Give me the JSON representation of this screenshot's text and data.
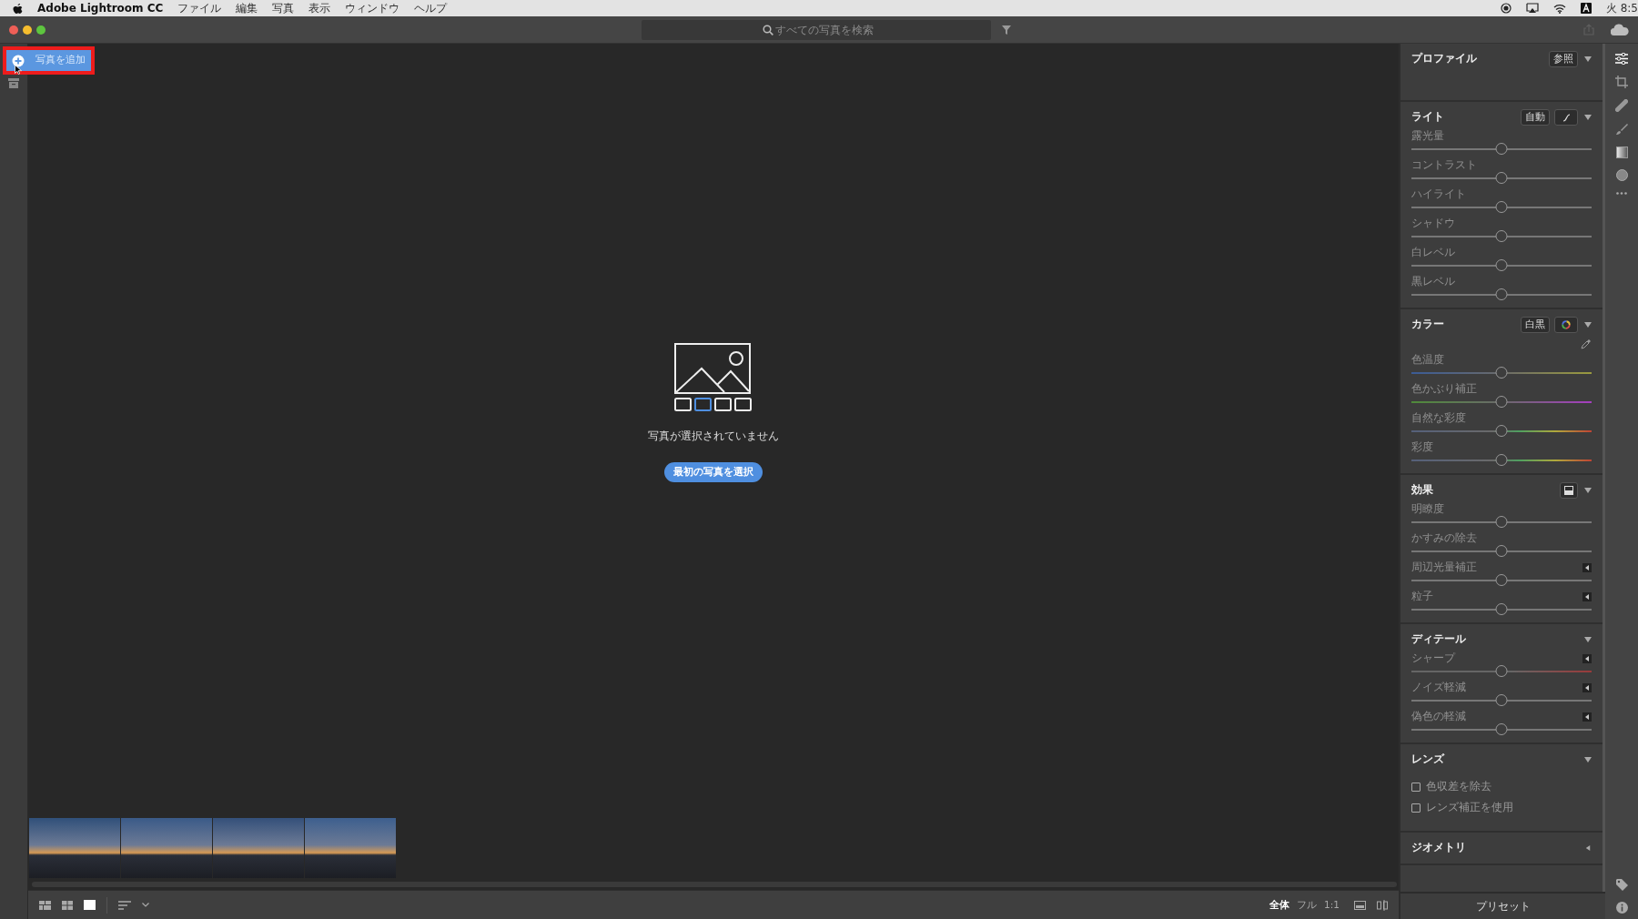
{
  "menu_bar": {
    "app_name": "Adobe Lightroom CC",
    "menus": [
      "ファイル",
      "編集",
      "写真",
      "表示",
      "ウィンドウ",
      "ヘルプ"
    ],
    "clock": "火 8:5"
  },
  "toolbar": {
    "search": {
      "placeholder": "すべての写真を検索"
    }
  },
  "add_photo_button": {
    "label": "写真を追加",
    "highlighted": true
  },
  "empty_state": {
    "message": "写真が選択されていません",
    "button": "最初の写真を選択"
  },
  "zoom_options": [
    {
      "label": "全体",
      "selected": true
    },
    {
      "label": "フル",
      "selected": false
    },
    {
      "label": "1:1",
      "selected": false
    }
  ],
  "edit_panel": {
    "sections": [
      {
        "title": "プロファイル",
        "expanded": true,
        "buttons": [
          {
            "kind": "text",
            "label": "参照"
          }
        ]
      },
      {
        "title": "ライト",
        "expanded": true,
        "buttons": [
          {
            "kind": "text",
            "label": "自動"
          },
          {
            "kind": "curve"
          }
        ],
        "sliders": [
          {
            "label": "露光量",
            "kind": "plain",
            "level": 0.5
          },
          {
            "label": "コントラスト",
            "kind": "plain",
            "level": 0.5
          },
          {
            "label": "ハイライト",
            "kind": "plain",
            "level": 0.5
          },
          {
            "label": "シャドウ",
            "kind": "plain",
            "level": 0.5
          },
          {
            "label": "白レベル",
            "kind": "plain",
            "level": 0.5
          },
          {
            "label": "黒レベル",
            "kind": "plain",
            "level": 0.5
          }
        ]
      },
      {
        "title": "カラー",
        "expanded": true,
        "buttons": [
          {
            "kind": "text",
            "label": "白黒"
          },
          {
            "kind": "wheel"
          }
        ],
        "eyedropper": true,
        "sliders": [
          {
            "label": "色温度",
            "kind": "temp",
            "level": 0.5
          },
          {
            "label": "色かぶり補正",
            "kind": "tint",
            "level": 0.5
          },
          {
            "label": "自然な彩度",
            "kind": "vibrance",
            "level": 0.5
          },
          {
            "label": "彩度",
            "kind": "vibrance",
            "level": 0.5
          }
        ]
      },
      {
        "title": "効果",
        "expanded": true,
        "buttons": [
          {
            "kind": "split"
          }
        ],
        "sliders": [
          {
            "label": "明瞭度",
            "kind": "plain",
            "level": 0.5
          },
          {
            "label": "かすみの除去",
            "kind": "plain",
            "level": 0.5
          },
          {
            "label": "周辺光量補正",
            "kind": "plain",
            "level": 0.5,
            "expanded": false
          },
          {
            "label": "粒子",
            "kind": "plain",
            "level": 0.5,
            "expanded": false
          }
        ]
      },
      {
        "title": "ディテール",
        "expanded": true,
        "sliders": [
          {
            "label": "シャープ",
            "kind": "sharpen",
            "level": 0.5,
            "expanded": false
          },
          {
            "label": "ノイズ軽減",
            "kind": "plain",
            "level": 0.5,
            "expanded": false
          },
          {
            "label": "偽色の軽減",
            "kind": "plain",
            "level": 0.5,
            "expanded": false
          }
        ]
      },
      {
        "title": "レンズ",
        "expanded": true,
        "checkboxes": [
          {
            "label": "色収差を除去",
            "checked": false
          },
          {
            "label": "レンズ補正を使用",
            "checked": false
          }
        ]
      },
      {
        "title": "ジオメトリ",
        "expanded": false
      }
    ],
    "presets_button": "プリセット"
  }
}
